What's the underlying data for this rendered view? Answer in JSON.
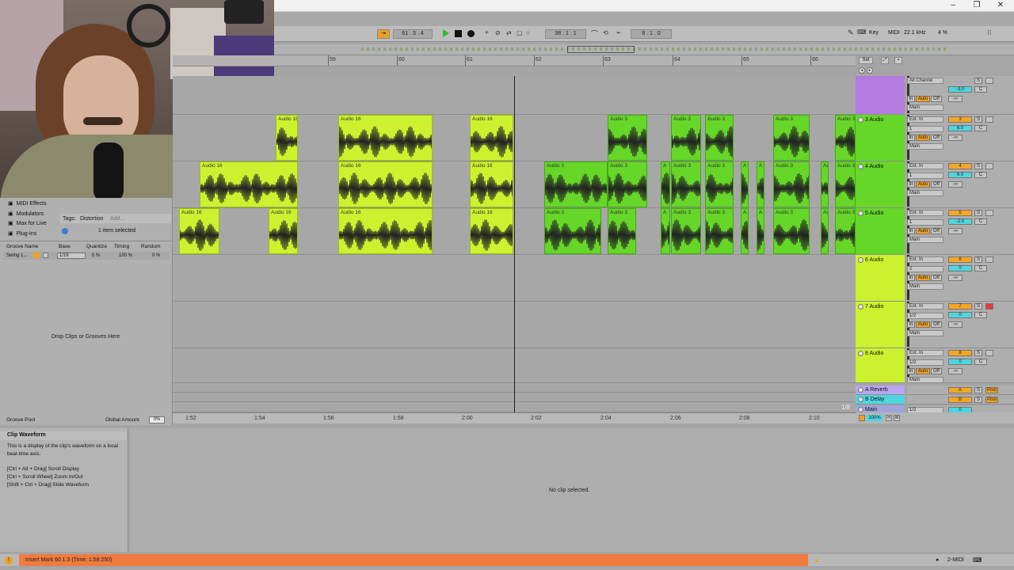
{
  "window": {
    "title": ""
  },
  "transport": {
    "position": "61 . 3 . 4",
    "tempo_pos": "38 . 1 . 1",
    "loop_len": "8 . 1 . 0",
    "key_label": "Key",
    "midi_label": "MIDI",
    "sample_rate": "22.1 kHz",
    "cpu": "4 %"
  },
  "ruler": {
    "bars": [
      "59",
      "60",
      "61",
      "62",
      "63",
      "64",
      "65",
      "66"
    ]
  },
  "set_label": "Set",
  "times": [
    "1:52",
    "1:54",
    "1:56",
    "1:58",
    "2:00",
    "2:02",
    "2:04",
    "2:06",
    "2:08",
    "2:10"
  ],
  "grid_label": "1/8",
  "clip_names": {
    "a16": "Audio 16",
    "a3": "Audio 3",
    "a3s": "A",
    "a3t": "Au"
  },
  "tracks": [
    {
      "name": "",
      "input": "All Channe",
      "monitor": "Main",
      "vol": "-3.0",
      "pan": "C",
      "send": "-∞",
      "num": ""
    },
    {
      "name": "3 Audio",
      "input": "Ext. In",
      "ch": "1",
      "monitor": "Main",
      "vol": "6.0",
      "pan": "C",
      "send": "-∞",
      "num": "3"
    },
    {
      "name": "4 Audio",
      "input": "Ext. In",
      "ch": "1",
      "monitor": "Main",
      "vol": "6.0",
      "pan": "C",
      "send": "-∞",
      "num": "4"
    },
    {
      "name": "5 Audio",
      "input": "Ext. In",
      "ch": "1",
      "monitor": "Main",
      "vol": "-2.0",
      "pan": "C",
      "send": "-∞",
      "num": "5"
    },
    {
      "name": "6 Audio",
      "input": "Ext. In",
      "ch": "2",
      "monitor": "Main",
      "vol": "0",
      "pan": "C",
      "send": "-∞",
      "num": "6"
    },
    {
      "name": "7 Audio",
      "input": "Ext. In",
      "ch": "1/2",
      "monitor": "Main",
      "vol": "0",
      "pan": "C",
      "send": "-∞",
      "num": "7"
    },
    {
      "name": "8 Audio",
      "input": "Ext. In",
      "ch": "1/2",
      "monitor": "Main",
      "vol": "0",
      "pan": "C",
      "send": "-∞",
      "num": "8"
    }
  ],
  "returns": [
    {
      "name": "A Reverb",
      "letter": "A",
      "post": "Post"
    },
    {
      "name": "B Delay",
      "letter": "B",
      "post": "Post"
    },
    {
      "name": "Main",
      "ch": "1/2",
      "vol": "0"
    }
  ],
  "io_labels": {
    "in": "In",
    "auto": "Auto",
    "off": "Off",
    "s": "S"
  },
  "browser": {
    "items": [
      "MIDI Effects",
      "Modulators",
      "Max for Live",
      "Plug-Ins"
    ],
    "tags_label": "Tags:",
    "tag": "Distortion",
    "add": "Add...",
    "selected": "1 item selected",
    "groove_cols": [
      "Groove Name",
      "Base",
      "Quantize",
      "Timing",
      "Random"
    ],
    "groove_row": {
      "name": "Swing 1...",
      "base": "1/16",
      "quantize": "0 %",
      "timing": "100 %",
      "random": "0 %"
    },
    "drop_hint": "Drop Clips or Grooves Here",
    "pool_label": "Groove Pool",
    "global_amount_label": "Global Amount",
    "global_amount": "0%"
  },
  "info": {
    "title": "Clip Waveform",
    "line1": "This is a display of the clip's waveform on a local beat-time axis.",
    "l2": "[Ctrl + Alt + Drag] Scroll Display",
    "l3": "[Ctrl + Scroll Wheel] Zoom In/Out",
    "l4": "[Shift + Ctrl + Drag] Slide Waveform"
  },
  "detail": {
    "empty": "No clip selected."
  },
  "status": {
    "text": "Insert Mark 60.1.3 (Time: 1:58:250)",
    "midi": "2-MIDI"
  },
  "zoom": "100%",
  "colors": {
    "yellow": "#cdf12f",
    "green": "#66d628",
    "purple": "#b57be0",
    "orange": "#f07b3f"
  }
}
